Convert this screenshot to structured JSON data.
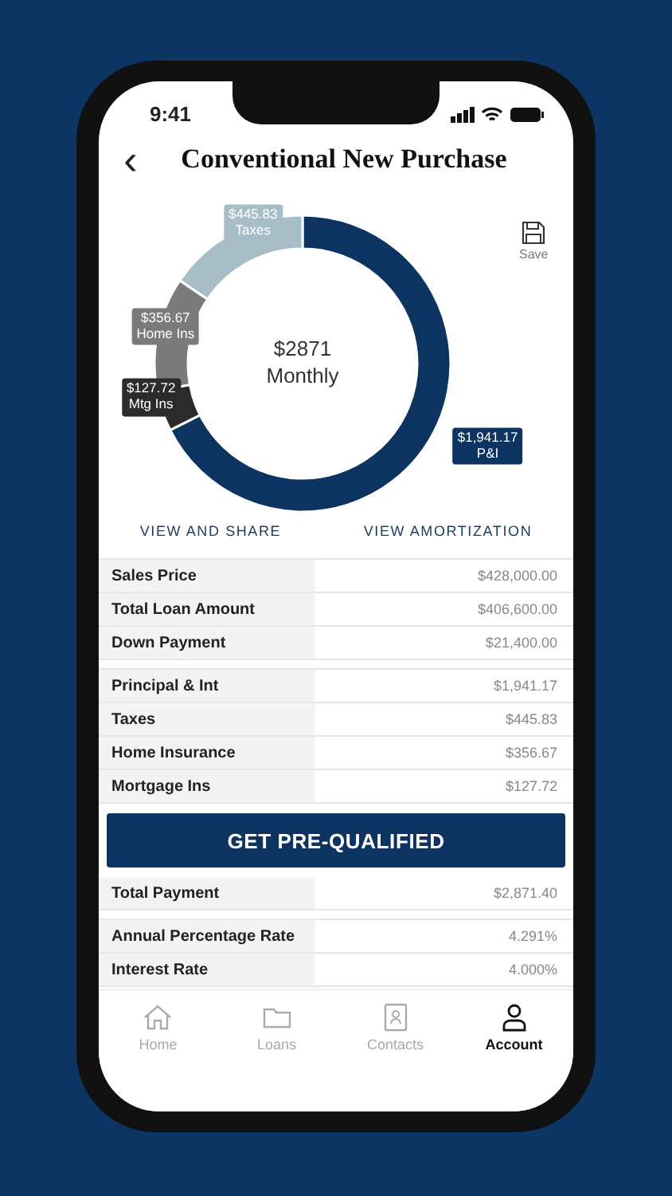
{
  "status_bar": {
    "time": "9:41"
  },
  "header": {
    "back": "‹",
    "title": "Conventional New Purchase"
  },
  "save": {
    "label": "Save"
  },
  "payment_chart": {
    "center_amount": "$2871",
    "center_caption": "Monthly",
    "chart_data": {
      "type": "donut",
      "categories": [
        "P&I",
        "Mtg Ins",
        "Home Ins",
        "Taxes"
      ],
      "series": [
        {
          "values": [
            67.6,
            4.45,
            12.42,
            15.53
          ]
        }
      ],
      "colors": [
        "#0d3460",
        "#2b2b2b",
        "#7b7b7b",
        "#a8bec7"
      ],
      "value_labels": [
        "$1,941.17",
        "$127.72",
        "$356.67",
        "$445.83"
      ]
    }
  },
  "links": [
    {
      "label": "VIEW AND SHARE"
    },
    {
      "label": "VIEW AMORTIZATION"
    }
  ],
  "loan_summary": [
    {
      "label": "Sales Price",
      "value": "$428,000.00"
    },
    {
      "label": "Total Loan Amount",
      "value": "$406,600.00"
    },
    {
      "label": "Down Payment",
      "value": "$21,400.00"
    }
  ],
  "payment_breakdown": [
    {
      "label": "Principal & Int",
      "value": "$1,941.17"
    },
    {
      "label": "Taxes",
      "value": "$445.83"
    },
    {
      "label": "Home Insurance",
      "value": "$356.67"
    },
    {
      "label": "Mortgage Ins",
      "value": "$127.72"
    }
  ],
  "cta_button": "GET PRE-QUALIFIED",
  "total": [
    {
      "label": "Total Payment",
      "value": "$2,871.40"
    }
  ],
  "rates": [
    {
      "label": "Annual Percentage Rate",
      "value": "4.291%"
    },
    {
      "label": "Interest Rate",
      "value": "4.000%"
    }
  ],
  "tab_bar": [
    {
      "label": "Home",
      "kind": "home",
      "selected": false
    },
    {
      "label": "Loans",
      "kind": "folder",
      "selected": false
    },
    {
      "label": "Contacts",
      "kind": "contacts",
      "selected": false
    },
    {
      "label": "Account",
      "kind": "person",
      "selected": true
    }
  ]
}
